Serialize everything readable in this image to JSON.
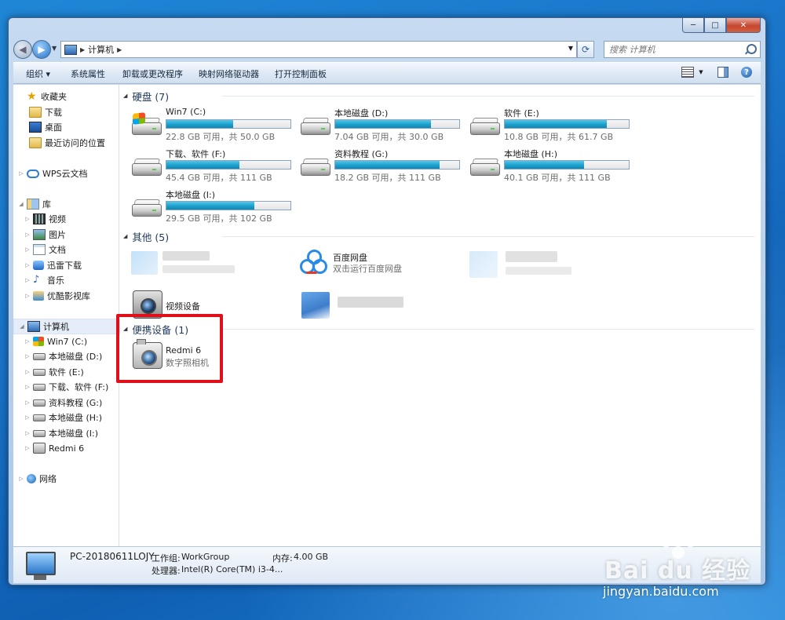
{
  "window": {
    "controls": {
      "minimize": "─",
      "maximize": "□",
      "close": "✕"
    }
  },
  "address_bar": {
    "path_segments": [
      "计算机"
    ],
    "search_placeholder": "搜索 计算机"
  },
  "toolbar": {
    "items": [
      "组织 ▾",
      "系统属性",
      "卸载或更改程序",
      "映射网络驱动器",
      "打开控制面板"
    ]
  },
  "navigation_pane": {
    "favorites": {
      "label": "收藏夹",
      "items": [
        "下载",
        "桌面",
        "最近访问的位置"
      ]
    },
    "wps": "WPS云文档",
    "libraries": {
      "label": "库",
      "items": [
        "视频",
        "图片",
        "文档",
        "迅雷下载",
        "音乐",
        "优酷影视库"
      ]
    },
    "computer": {
      "label": "计算机",
      "items": [
        "Win7 (C:)",
        "本地磁盘 (D:)",
        "软件 (E:)",
        "下载、软件 (F:)",
        "资料教程 (G:)",
        "本地磁盘 (H:)",
        "本地磁盘 (I:)",
        "Redmi 6"
      ]
    },
    "network": "网络"
  },
  "groups": {
    "hard_disks": "硬盘 (7)",
    "other": "其他 (5)",
    "portable": "便携设备 (1)"
  },
  "drives": [
    {
      "name": "Win7 (C:)",
      "space": "22.8 GB 可用，共 50.0 GB",
      "used_fraction": 0.54,
      "icon": "windows-drive-icon"
    },
    {
      "name": "本地磁盘 (D:)",
      "space": "7.04 GB 可用，共 30.0 GB",
      "used_fraction": 0.77,
      "icon": "hard-drive-icon"
    },
    {
      "name": "软件 (E:)",
      "space": "10.8 GB 可用，共 61.7 GB",
      "used_fraction": 0.82,
      "icon": "hard-drive-icon"
    },
    {
      "name": "下载、软件 (F:)",
      "space": "45.4 GB 可用，共 111 GB",
      "used_fraction": 0.59,
      "icon": "hard-drive-icon"
    },
    {
      "name": "资料教程 (G:)",
      "space": "18.2 GB 可用，共 111 GB",
      "used_fraction": 0.84,
      "icon": "hard-drive-icon"
    },
    {
      "name": "本地磁盘 (H:)",
      "space": "40.1 GB 可用，共 111 GB",
      "used_fraction": 0.64,
      "icon": "hard-drive-icon"
    },
    {
      "name": "本地磁盘 (I:)",
      "space": "29.5 GB 可用，共 102 GB",
      "used_fraction": 0.71,
      "icon": "hard-drive-icon"
    }
  ],
  "other_items": {
    "baidu": {
      "name": "百度网盘",
      "sub": "双击运行百度网盘",
      "icon": "baidu-netdisk-icon"
    },
    "video_device": {
      "name": "视频设备",
      "icon": "webcam-icon"
    }
  },
  "portable_devices": [
    {
      "name": "Redmi 6",
      "sub": "数字照相机",
      "icon": "camera-icon"
    }
  ],
  "details": {
    "pc_name": "PC-20180611LOJY",
    "workgroup_label": "工作组:",
    "workgroup": "WorkGroup",
    "memory_label": "内存:",
    "memory": "4.00 GB",
    "processor_label": "处理器:",
    "processor": "Intel(R) Core(TM) i3-4..."
  },
  "watermark": {
    "logo": "Bai  du 经验",
    "url": "jingyan.baidu.com"
  }
}
